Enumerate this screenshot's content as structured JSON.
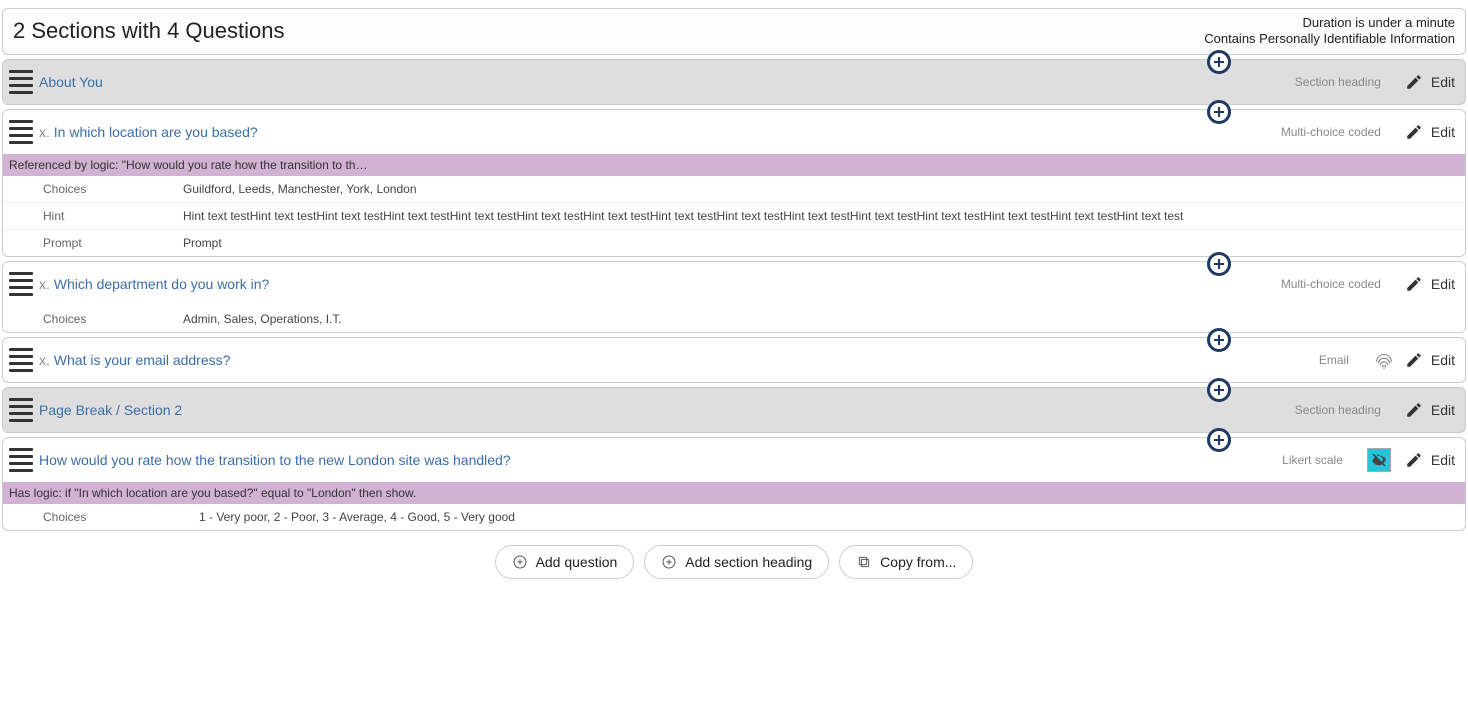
{
  "header": {
    "title": "2 Sections with 4 Questions",
    "duration": "Duration is under a minute",
    "pii": "Contains Personally Identifiable Information"
  },
  "sectionHeadingLabel": "Section heading",
  "editLabel": "Edit",
  "sections": [
    {
      "title": "About You"
    }
  ],
  "q1": {
    "prefix": "x.",
    "title": "In which location are you based?",
    "type": "Multi-choice coded",
    "logicRef": "Referenced by logic: \"How would you rate how the transition to th…",
    "choicesLabel": "Choices",
    "choices": "Guildford, Leeds, Manchester, York, London",
    "hintLabel": "Hint",
    "hint": "Hint text testHint text testHint text testHint text testHint text testHint text testHint text testHint text testHint text testHint text testHint text testHint text testHint text testHint text testHint text test",
    "promptLabel": "Prompt",
    "prompt": "Prompt"
  },
  "q2": {
    "prefix": "x.",
    "title": "Which department do you work in?",
    "type": "Multi-choice coded",
    "choicesLabel": "Choices",
    "choices": "Admin, Sales, Operations, I.T."
  },
  "q3": {
    "prefix": "x.",
    "title": "What is your email address?",
    "type": "Email"
  },
  "pageBreak": {
    "label": "Page Break",
    "sep": " / ",
    "section": "Section 2"
  },
  "q4": {
    "title": "How would you rate how the transition to the new London site was handled?",
    "type": "Likert scale",
    "logic": "Has logic: if \"In which location are you based?\" equal to \"London\" then show.",
    "choicesLabel": "Choices",
    "choices": "1 - Very poor, 2 - Poor, 3 - Average, 4 - Good, 5 - Very good"
  },
  "actions": {
    "addQuestion": "Add question",
    "addSection": "Add section heading",
    "copyFrom": "Copy from..."
  }
}
